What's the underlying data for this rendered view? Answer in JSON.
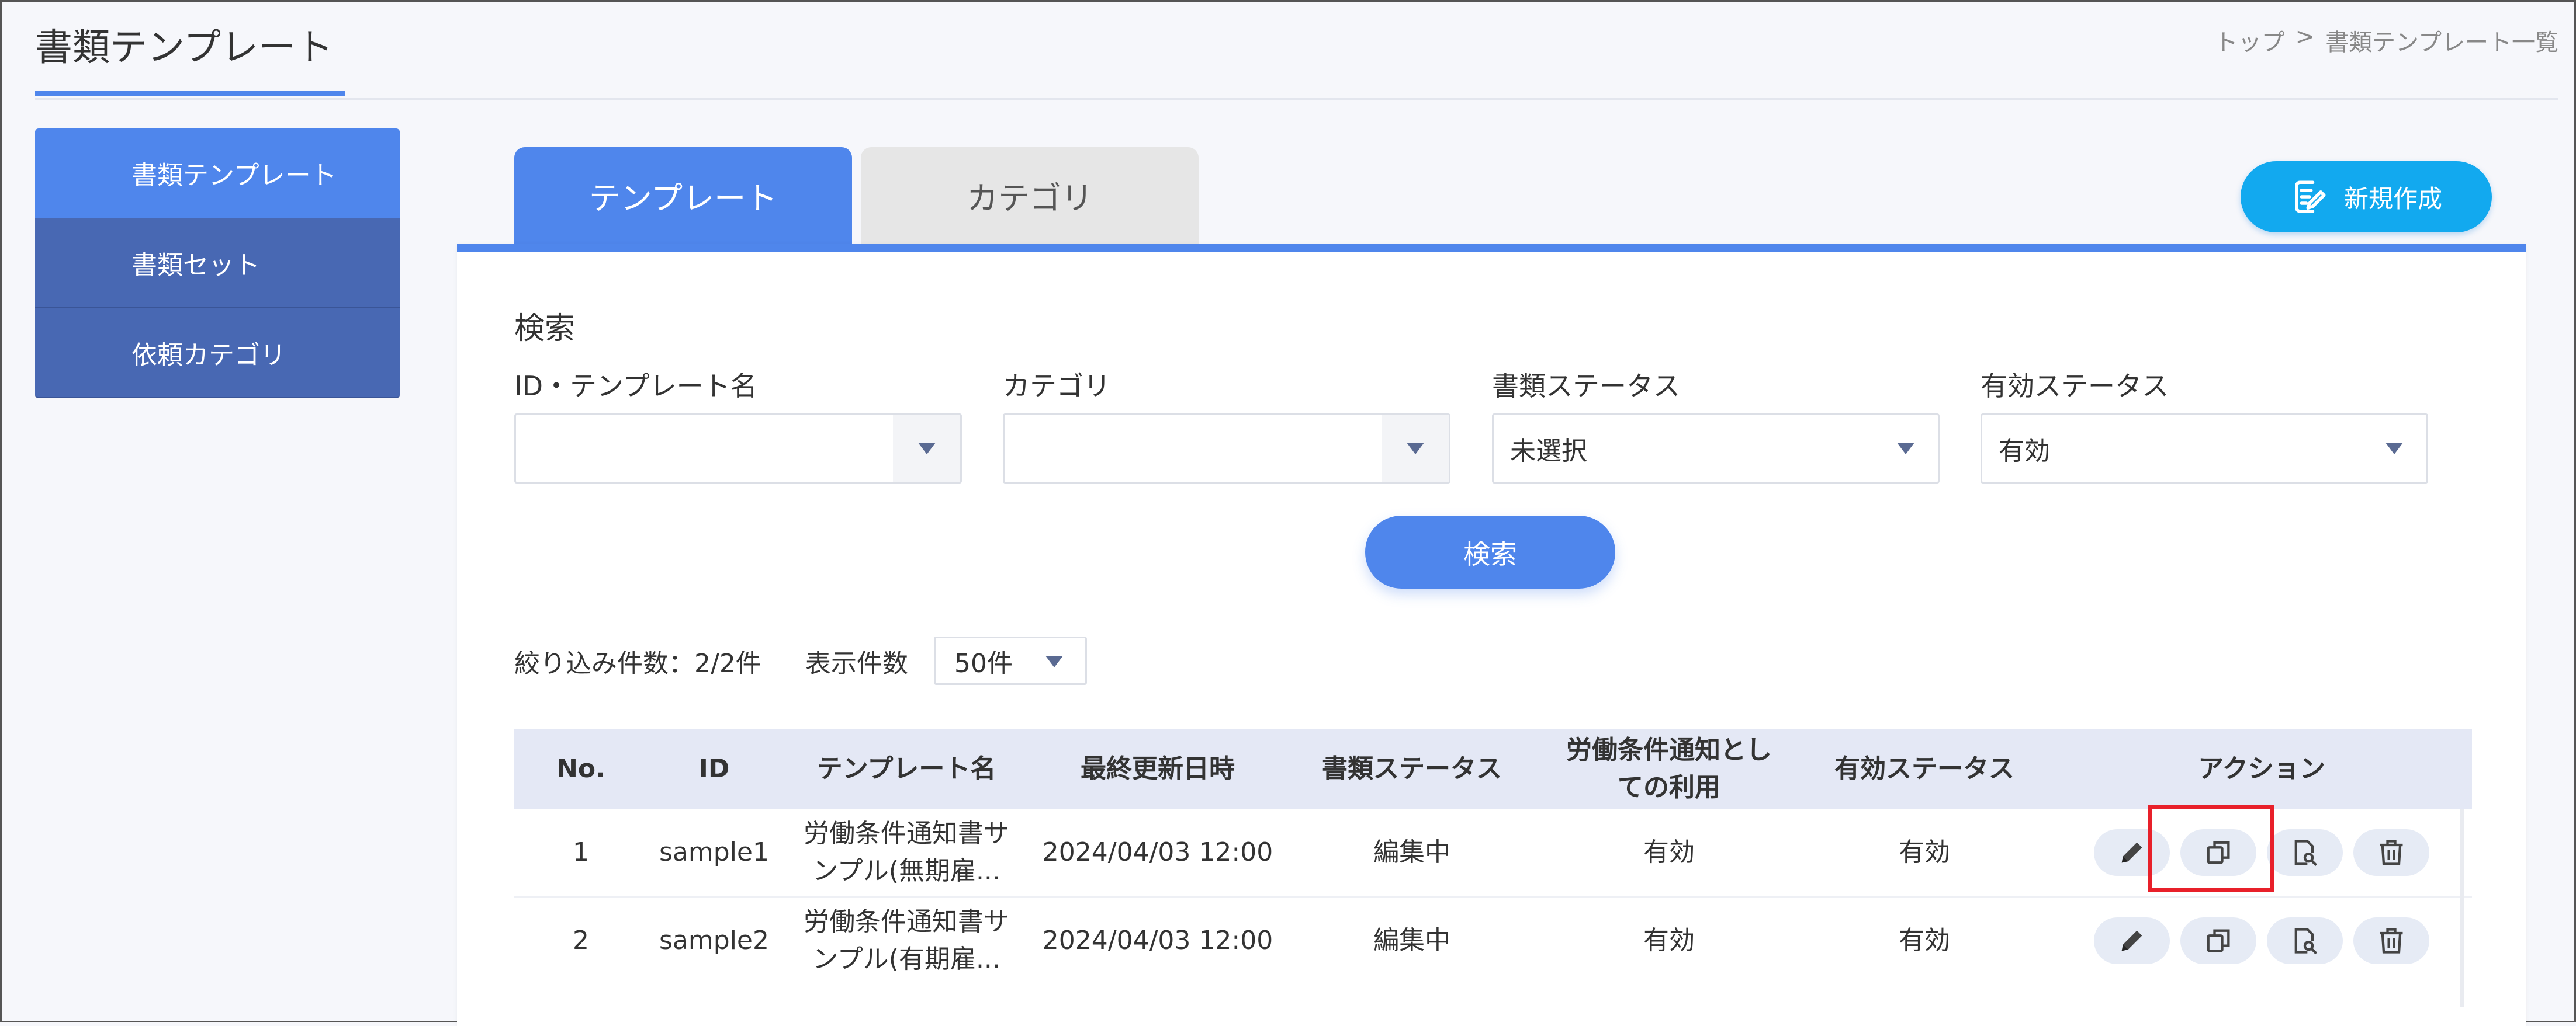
{
  "header": {
    "title": "書類テンプレート",
    "breadcrumb": {
      "top": "トップ",
      "separator": ">",
      "current": "書類テンプレート一覧"
    }
  },
  "sidebar": {
    "items": [
      {
        "label": "書類テンプレート",
        "active": true
      },
      {
        "label": "書類セット",
        "active": false
      },
      {
        "label": "依頼カテゴリ",
        "active": false
      }
    ]
  },
  "tabs": [
    {
      "label": "テンプレート",
      "active": true
    },
    {
      "label": "カテゴリ",
      "active": false
    }
  ],
  "new_button": {
    "label": "新規作成",
    "icon": "document-edit-icon"
  },
  "search": {
    "heading": "検索",
    "fields": [
      {
        "label": "ID・テンプレート名",
        "value": ""
      },
      {
        "label": "カテゴリ",
        "value": ""
      },
      {
        "label": "書類ステータス",
        "value": "未選択"
      },
      {
        "label": "有効ステータス",
        "value": "有効"
      }
    ],
    "button_label": "検索"
  },
  "results": {
    "filter_count": "絞り込み件数：2/2件",
    "display_label": "表示件数",
    "page_size": "50件"
  },
  "table": {
    "headers": {
      "no": "No.",
      "id": "ID",
      "name": "テンプレート名",
      "updated": "最終更新日時",
      "doc_status": "書類ステータス",
      "labor_use": "労働条件通知としての利用",
      "valid_status": "有効ステータス",
      "actions": "アクション"
    },
    "rows": [
      {
        "no": "1",
        "id": "sample1",
        "name": "労働条件通知書サンプル(無期雇...",
        "updated": "2024/04/03 12:00",
        "doc_status": "編集中",
        "labor_use": "有効",
        "valid_status": "有効"
      },
      {
        "no": "2",
        "id": "sample2",
        "name": "労働条件通知書サンプル(有期雇...",
        "updated": "2024/04/03 12:00",
        "doc_status": "編集中",
        "labor_use": "有効",
        "valid_status": "有効"
      }
    ],
    "action_icons": [
      "pencil-icon",
      "copy-icon",
      "preview-icon",
      "trash-icon"
    ]
  },
  "colors": {
    "primary": "#4f86ec",
    "sidebar": "#4868b3",
    "new_button": "#12a9ef",
    "highlight": "#e8202a"
  }
}
